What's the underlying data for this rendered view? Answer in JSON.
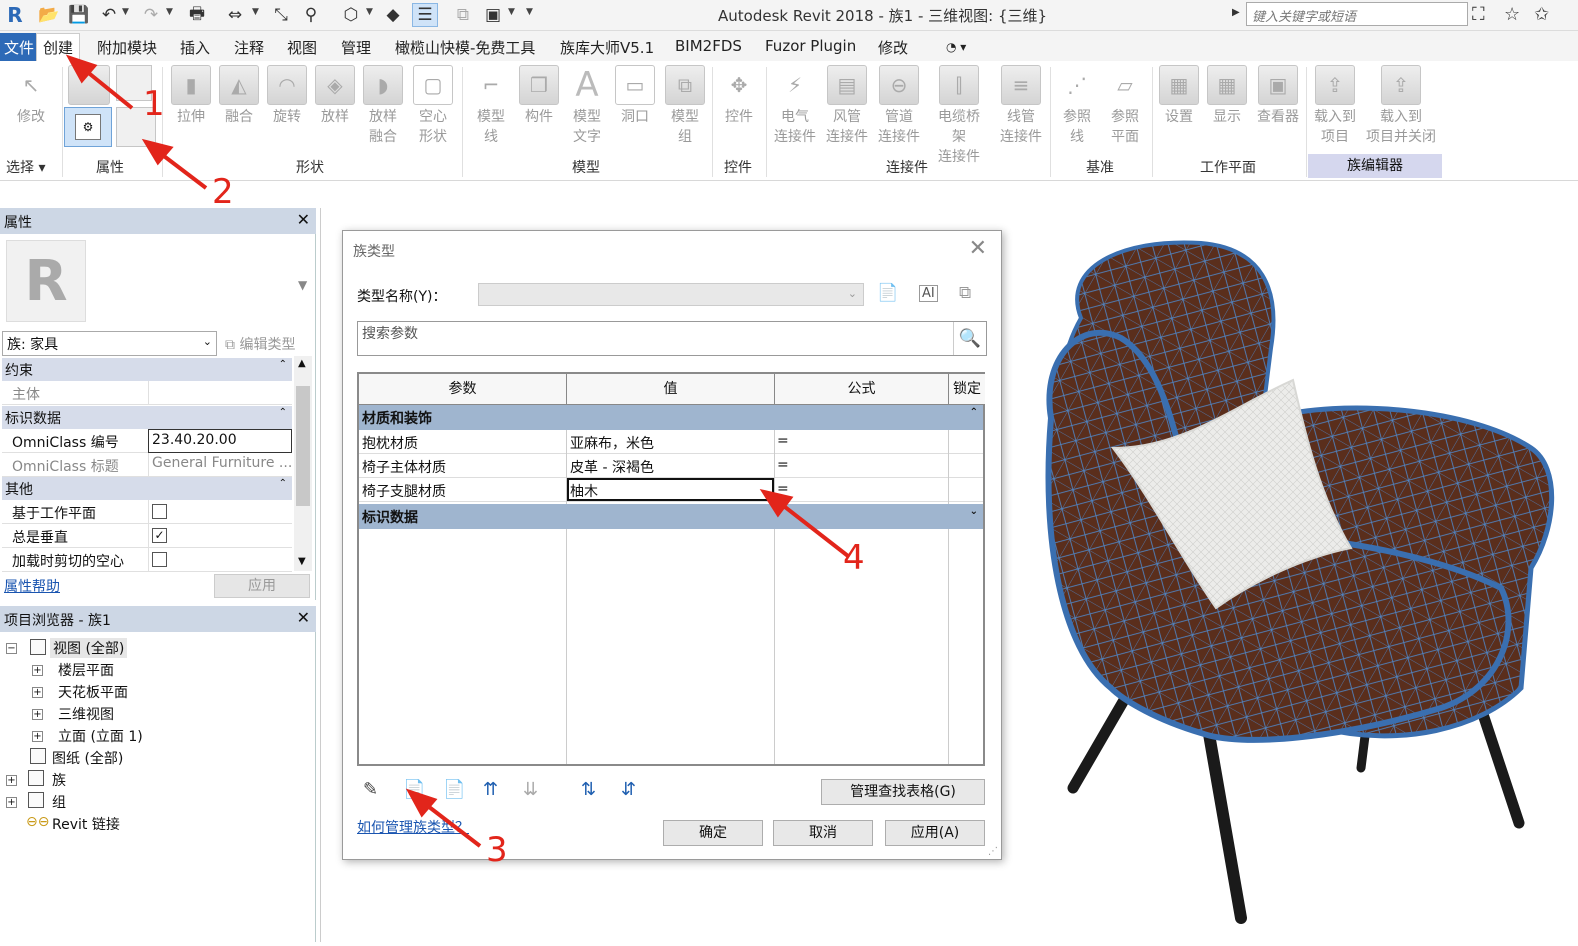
{
  "titlebar": {
    "app_title": "Autodesk Revit 2018 -     族1 - 三维视图: {三维}",
    "search_placeholder": "键入关键字或短语"
  },
  "menu": {
    "tabs": [
      "文件",
      "创建",
      "附加模块",
      "插入",
      "注释",
      "视图",
      "管理",
      "橄榄山快模-免费工具",
      "族库大师V5.1",
      "BIM2FDS",
      "Fuzor Plugin",
      "修改"
    ],
    "active": "创建"
  },
  "ribbon": {
    "select": {
      "modify": "修改",
      "panel": "选择"
    },
    "properties_panel": "属性",
    "shape_panel": "形状",
    "shape_buttons": [
      "拉伸",
      "融合",
      "旋转",
      "放样",
      "放样\n融合",
      "空心\n形状"
    ],
    "model_panel": "模型",
    "model_buttons": [
      "模型\n线",
      "构件",
      "模型\n文字",
      "洞口",
      "模型\n组"
    ],
    "control_panel": "控件",
    "control_button": "控件",
    "connector_panel": "连接件",
    "connector_buttons": [
      "电气\n连接件",
      "风管\n连接件",
      "管道\n连接件",
      "电缆桥架\n连接件",
      "线管\n连接件"
    ],
    "datum_panel": "基准",
    "datum_buttons": [
      "参照\n线",
      "参照\n平面"
    ],
    "workplane_panel": "工作平面",
    "workplane_buttons": [
      "设置",
      "显示",
      "查看器"
    ],
    "family_editor_panel": "族编辑器",
    "family_editor_buttons": [
      "载入到\n项目",
      "载入到\n项目并关闭"
    ]
  },
  "properties": {
    "title": "属性",
    "family_select": "族: 家具",
    "edit_type": "编辑类型",
    "groups": {
      "constraints": "约束",
      "identity": "标识数据",
      "other": "其他"
    },
    "rows": {
      "host": {
        "label": "主体",
        "value": ""
      },
      "omniclass_number": {
        "label": "OmniClass 编号",
        "value": "23.40.20.00"
      },
      "omniclass_title": {
        "label": "OmniClass 标题",
        "value": "General Furniture ..."
      },
      "work_plane_based": {
        "label": "基于工作平面",
        "checked": false
      },
      "always_vertical": {
        "label": "总是垂直",
        "checked": true
      },
      "cut_voids": {
        "label": "加载时剪切的空心",
        "checked": false
      }
    },
    "help": "属性帮助",
    "apply": "应用"
  },
  "browser": {
    "title": "项目浏览器 - 族1",
    "nodes": {
      "views": "视图 (全部)",
      "floor_plans": "楼层平面",
      "ceiling_plans": "天花板平面",
      "views_3d": "三维视图",
      "elevations": "立面 (立面 1)",
      "sheets": "图纸 (全部)",
      "families": "族",
      "groups": "组",
      "revit_links": "Revit 链接"
    }
  },
  "dialog": {
    "title": "族类型",
    "type_name_label": "类型名称(Y)：",
    "search_placeholder": "搜索参数",
    "columns": [
      "参数",
      "值",
      "公式",
      "锁定"
    ],
    "sections": {
      "materials": "材质和装饰",
      "identity": "标识数据"
    },
    "rows": [
      {
        "param": "抱枕材质",
        "value": "亚麻布，米色",
        "formula": "="
      },
      {
        "param": "椅子主体材质",
        "value": "皮革 - 深褐色",
        "formula": "="
      },
      {
        "param": "椅子支腿材质",
        "value": "柚木",
        "formula": "="
      }
    ],
    "manage_lookup": "管理查找表格(G)",
    "help_link": "如何管理族类型？",
    "ok": "确定",
    "cancel": "取消",
    "apply": "应用(A)"
  },
  "annotations": {
    "n1": "1",
    "n2": "2",
    "n3": "3",
    "n4": "4"
  },
  "colors": {
    "accent": "#2d6ab7",
    "annotation": "#e2251b",
    "wire": "#4f86c6",
    "leather": "#5a2e1c"
  }
}
